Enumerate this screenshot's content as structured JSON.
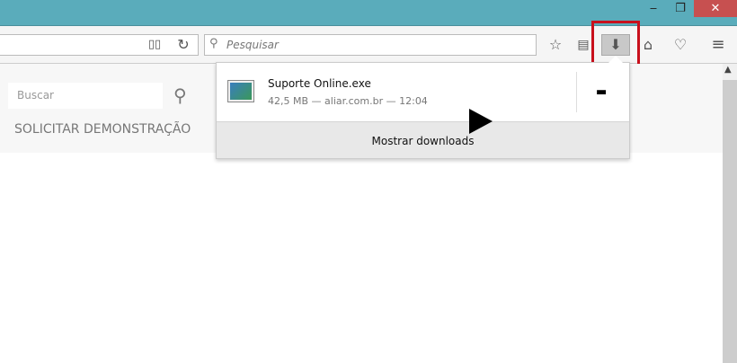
{
  "window": {
    "minimize": "‒",
    "restore": "❐",
    "close": "✕"
  },
  "toolbar": {
    "search_placeholder": "Pesquisar"
  },
  "page": {
    "search_placeholder": "Buscar",
    "demo_link": "SOLICITAR DEMONSTRAÇÃO"
  },
  "downloads": {
    "items": [
      {
        "name": "Suporte Online.exe",
        "meta": "42,5 MB — aliar.com.br — 12:04"
      }
    ],
    "show_all": "Mostrar downloads"
  },
  "colors": {
    "titlebar": "#5aacbb",
    "close": "#c75050",
    "highlight": "#c8101c"
  }
}
